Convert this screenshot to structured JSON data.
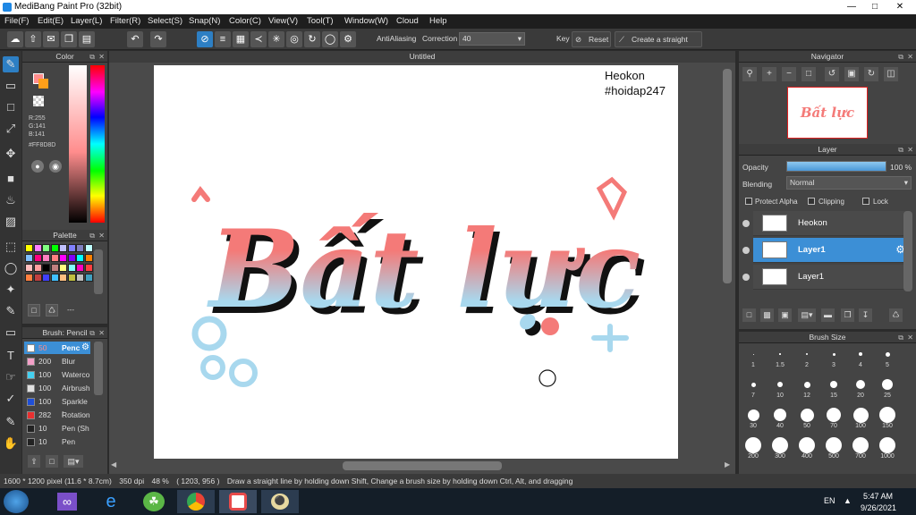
{
  "app": {
    "title": "MediBang Paint Pro (32bit)"
  },
  "menu": [
    "File(F)",
    "Edit(E)",
    "Layer(L)",
    "Filter(R)",
    "Select(S)",
    "Snap(N)",
    "Color(C)",
    "View(V)",
    "Tool(T)",
    "Window(W)",
    "Cloud",
    "Help"
  ],
  "toolbar": {
    "antialiasing_label": "AntiAliasing",
    "correction_label": "Correction",
    "correction_value": "40",
    "key_label": "Key",
    "reset_label": "Reset",
    "straight_line_label": "Create a straight line"
  },
  "document": {
    "tab_title": "Untitled",
    "watermark_line1": "Heokon",
    "watermark_line2": "#hoidap247"
  },
  "color_panel": {
    "title": "Color",
    "r": "R:255",
    "g": "G:141",
    "b": "B:141",
    "hex": "#FF8D8D",
    "fg_color": "#FF8D8D"
  },
  "palette_panel": {
    "title": "Palette",
    "menu_label": "---"
  },
  "brush_panel": {
    "title": "Brush: Pencil",
    "items": [
      {
        "size": "50",
        "name": "Penc",
        "color": "#ffffff",
        "selected": true
      },
      {
        "size": "200",
        "name": "Blur",
        "color": "#f4a0c8",
        "selected": false
      },
      {
        "size": "100",
        "name": "Waterco",
        "color": "#44d0f0",
        "selected": false
      },
      {
        "size": "100",
        "name": "Airbrush",
        "color": "#e0e0e0",
        "selected": false
      },
      {
        "size": "100",
        "name": "Sparkle I",
        "color": "#1f4fd8",
        "selected": false
      },
      {
        "size": "282",
        "name": "Rotation",
        "color": "#e83030",
        "selected": false
      },
      {
        "size": "10",
        "name": "Pen (Sh",
        "color": "#222222",
        "selected": false
      },
      {
        "size": "10",
        "name": "Pen",
        "color": "#222222",
        "selected": false
      }
    ]
  },
  "navigator": {
    "title": "Navigator",
    "thumb_text": "Bất lực"
  },
  "layer_panel": {
    "title": "Layer",
    "opacity_label": "Opacity",
    "opacity_value": "100 %",
    "opacity_fraction": 1.0,
    "blending_label": "Blending",
    "blending_value": "Normal",
    "protect_alpha": "Protect Alpha",
    "clipping": "Clipping",
    "lock": "Lock",
    "layers": [
      {
        "name": "Heokon",
        "selected": false
      },
      {
        "name": "Layer1",
        "selected": true
      },
      {
        "name": "Layer1",
        "selected": false
      }
    ]
  },
  "brush_size": {
    "title": "Brush Size",
    "sizes": [
      "1",
      "1.5",
      "2",
      "3",
      "4",
      "5",
      "7",
      "10",
      "12",
      "15",
      "20",
      "25",
      "30",
      "40",
      "50",
      "70",
      "100",
      "150",
      "200",
      "300",
      "400",
      "500",
      "700",
      "1000"
    ]
  },
  "status": {
    "dims": "1600 * 1200 pixel",
    "physical": "(11.6 * 8.7cm)",
    "dpi": "350 dpi",
    "zoom": "48 %",
    "coords": "( 1203, 956 )",
    "hint": "Draw a straight line by holding down Shift, Change a brush size by holding down Ctrl, Alt, and dragging"
  },
  "taskbar": {
    "lang": "EN",
    "time": "5:47 AM",
    "date": "9/26/2021"
  },
  "artwork": {
    "text": "Bất lực",
    "grad_top": "#f47a78",
    "grad_bottom": "#a8d8ee"
  }
}
